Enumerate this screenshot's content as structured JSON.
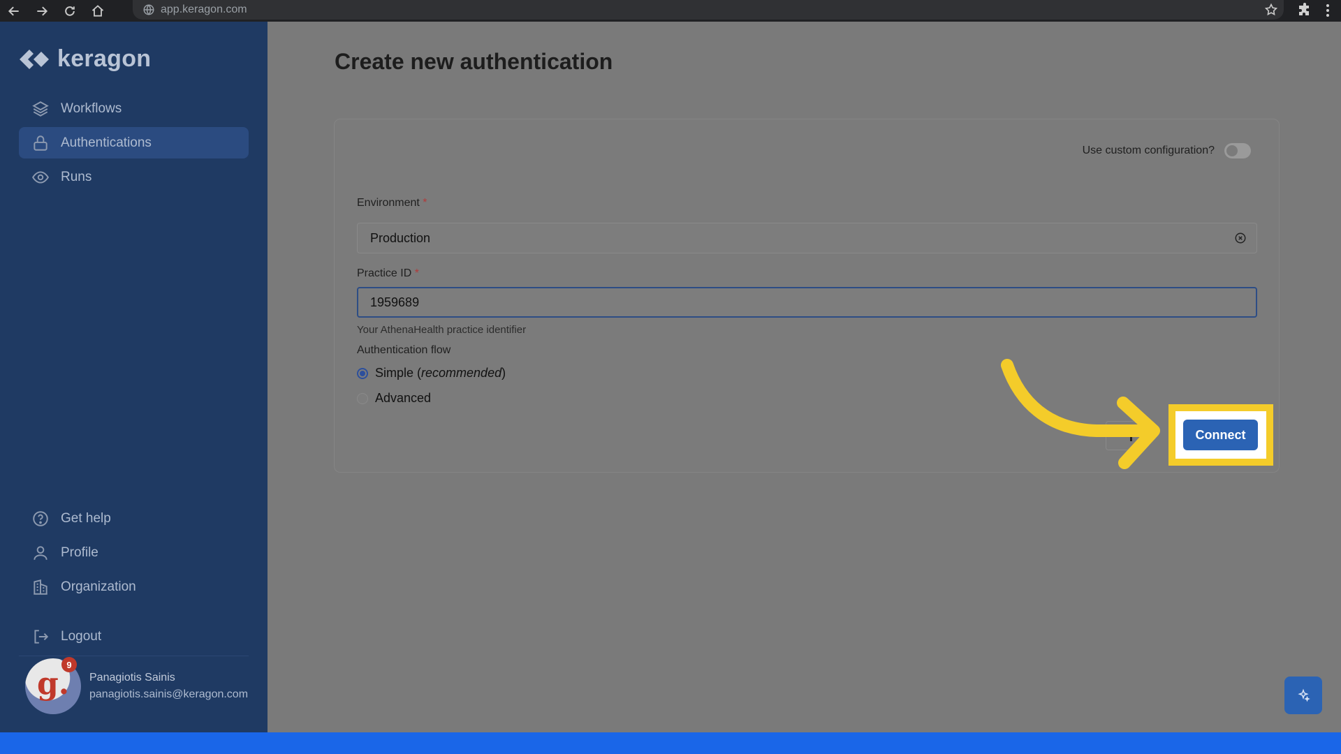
{
  "browser": {
    "url": "app.keragon.com",
    "icons": [
      "back-icon",
      "forward-icon",
      "reload-icon",
      "home-icon",
      "site-info-icon",
      "bookmark-star-icon",
      "extensions-icon",
      "menu-kebab-icon"
    ]
  },
  "sidebar": {
    "brand": "keragon",
    "nav": [
      {
        "label": "Workflows",
        "icon": "layers-icon",
        "active": false
      },
      {
        "label": "Authentications",
        "icon": "lock-icon",
        "active": true
      },
      {
        "label": "Runs",
        "icon": "eye-icon",
        "active": false
      }
    ],
    "bottom_nav": [
      {
        "label": "Get help",
        "icon": "help-circle-icon"
      },
      {
        "label": "Profile",
        "icon": "user-icon"
      },
      {
        "label": "Organization",
        "icon": "building-icon"
      },
      {
        "label": "Logout",
        "icon": "logout-icon"
      }
    ],
    "user": {
      "name": "Panagiotis Sainis",
      "email": "panagiotis.sainis@keragon.com",
      "avatar_letter": "g.",
      "notification_count": "9"
    }
  },
  "main": {
    "title": "Create new authentication",
    "custom_config_label": "Use custom configuration?",
    "custom_config_enabled": false,
    "environment": {
      "label": "Environment",
      "required_mark": "*",
      "value": "Production"
    },
    "practice_id": {
      "label": "Practice ID",
      "required_mark": "*",
      "value": "1959689",
      "helper": "Your AthenaHealth practice identifier"
    },
    "auth_flow": {
      "label": "Authentication flow",
      "options": [
        {
          "label": "Simple",
          "note": "recommended",
          "checked": true
        },
        {
          "label": "Advanced",
          "checked": false
        }
      ]
    },
    "connect_label": "Connect"
  },
  "colors": {
    "sidebar_bg": "#1f3a63",
    "accent": "#2b63b4",
    "highlight": "#f4cc2a",
    "required": "#b13a3a"
  }
}
